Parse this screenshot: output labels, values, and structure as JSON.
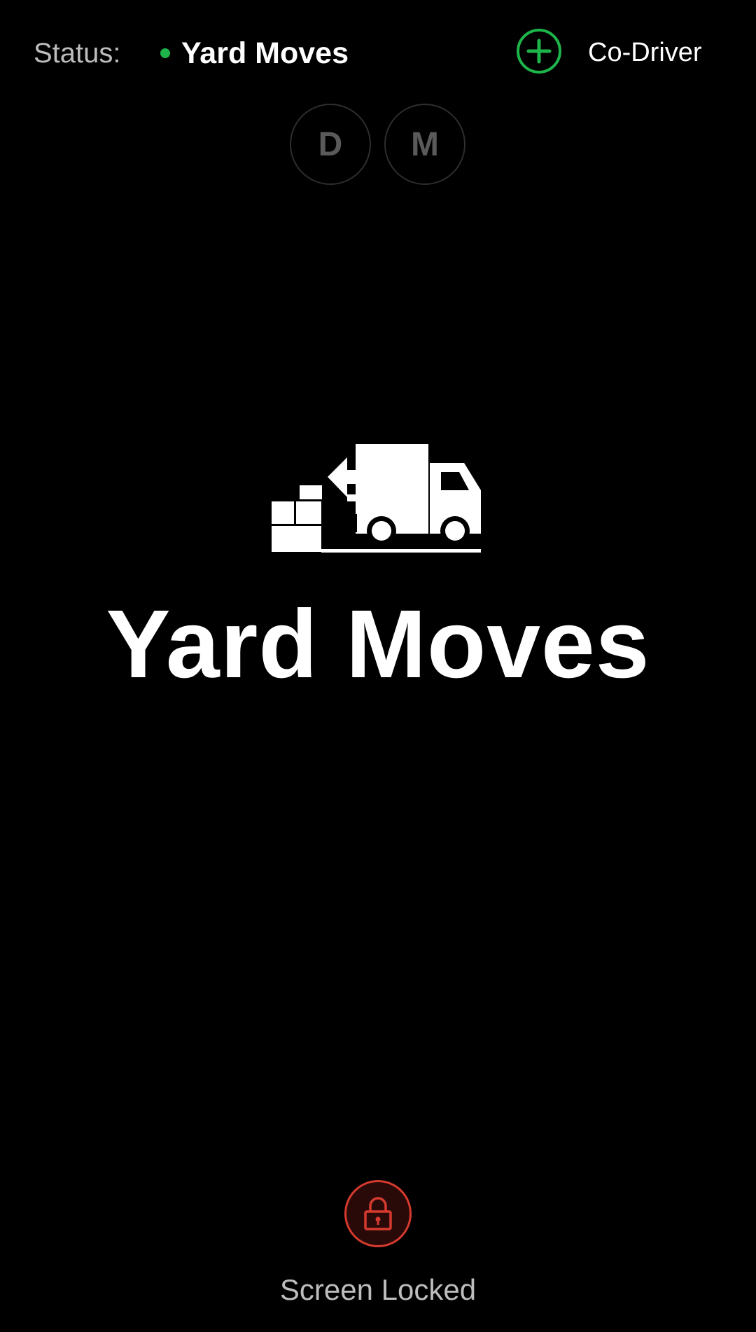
{
  "status": {
    "label": "Status:",
    "value": "Yard Moves",
    "dot_color": "#1db44a"
  },
  "co_driver": {
    "label": "Co-Driver",
    "icon": "plus-circle-icon",
    "accent_color": "#1db44a"
  },
  "mode_toggles": [
    {
      "label": "D"
    },
    {
      "label": "M"
    }
  ],
  "hero": {
    "icon": "yard-moves-truck-icon",
    "title": "Yard Moves"
  },
  "lock": {
    "icon": "lock-icon",
    "label": "Screen Locked",
    "color": "#d63a2f",
    "fill_color": "#2a0a08"
  }
}
